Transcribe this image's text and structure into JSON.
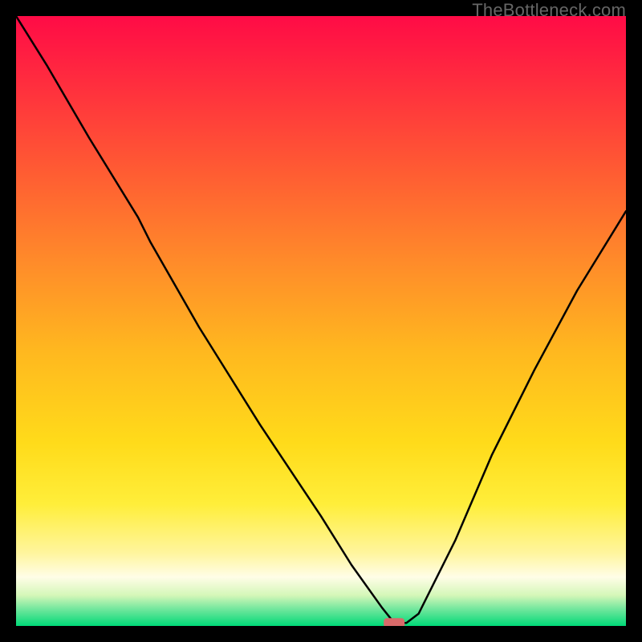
{
  "site_label": "TheBottleneck.com",
  "colors": {
    "gradient_top": "#ff1744",
    "gradient_mid1": "#ff5722",
    "gradient_mid2": "#ffc107",
    "gradient_mid3": "#ffeb3b",
    "gradient_low": "#fff59d",
    "gradient_green": "#00e676",
    "curve": "#000000",
    "marker": "#d86a6a"
  },
  "chart_data": {
    "type": "line",
    "title": "",
    "xlabel": "",
    "ylabel": "",
    "xlim": [
      0,
      100
    ],
    "ylim": [
      0,
      100
    ],
    "curve": {
      "x": [
        0,
        5,
        12,
        20,
        22,
        30,
        40,
        50,
        55,
        60,
        62,
        64,
        66,
        72,
        78,
        85,
        92,
        100
      ],
      "y": [
        100,
        92,
        80,
        67,
        63,
        49,
        33,
        18,
        10,
        3,
        0.5,
        0.5,
        2,
        14,
        28,
        42,
        55,
        68
      ]
    },
    "flat_segment": {
      "x_start": 60,
      "x_end": 64,
      "y": 0.5
    },
    "marker": {
      "x": 62,
      "y": 0.5,
      "shape": "rounded-rect"
    }
  }
}
